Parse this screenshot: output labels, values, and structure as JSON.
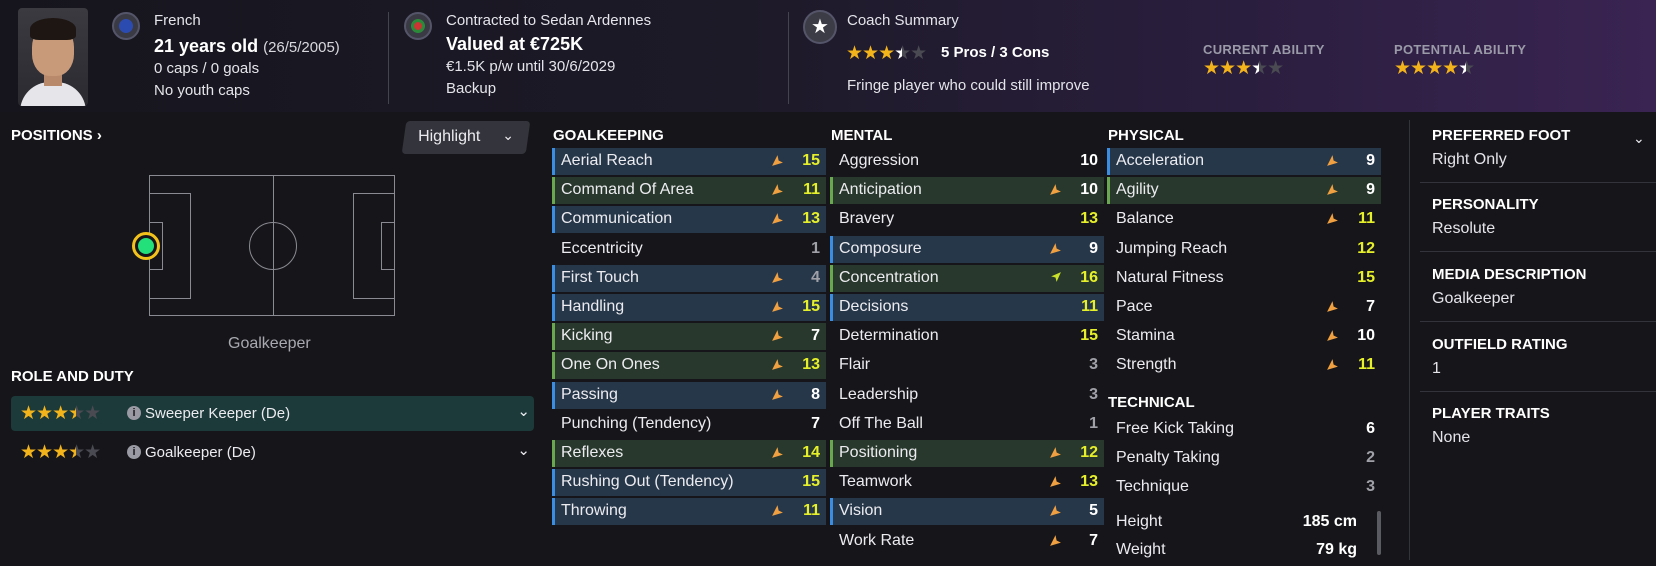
{
  "header": {
    "nationality": "French",
    "age": "21 years old",
    "dob": "(26/5/2005)",
    "caps": "0 caps / 0 goals",
    "youth_caps": "No youth caps",
    "contract_club": "Contracted to Sedan Ardennes",
    "value": "Valued at €725K",
    "wage": "€1.5K p/w until 30/6/2029",
    "squad_status": "Backup",
    "coach_title": "Coach Summary",
    "pros_cons": "5 Pros / 3 Cons",
    "coach_note": "Fringe player who could still improve",
    "coach_stars": 3.5,
    "current_ability_label": "CURRENT ABILITY",
    "current_ability_stars": 3.5,
    "potential_ability_label": "POTENTIAL ABILITY",
    "potential_ability_stars": 4.5
  },
  "positions": {
    "title": "POSITIONS",
    "highlight_label": "Highlight",
    "position_name": "Goalkeeper",
    "role_title": "ROLE AND DUTY",
    "roles": [
      {
        "name": "Sweeper Keeper (De)",
        "stars": 3.5,
        "selected": true
      },
      {
        "name": "Goalkeeper (De)",
        "stars": 3.5,
        "selected": false
      }
    ]
  },
  "goalkeeping": {
    "title": "GOALKEEPING",
    "items": [
      {
        "name": "Aerial Reach",
        "value": "15",
        "hl": "blue",
        "arrow": true
      },
      {
        "name": "Command Of Area",
        "value": "11",
        "hl": "green",
        "arrow": true
      },
      {
        "name": "Communication",
        "value": "13",
        "hl": "blue",
        "arrow": true
      },
      {
        "name": "Eccentricity",
        "value": "1",
        "hl": "",
        "arrow": false
      },
      {
        "name": "First Touch",
        "value": "4",
        "hl": "blue",
        "arrow": true
      },
      {
        "name": "Handling",
        "value": "15",
        "hl": "blue",
        "arrow": true
      },
      {
        "name": "Kicking",
        "value": "7",
        "hl": "green",
        "arrow": true
      },
      {
        "name": "One On Ones",
        "value": "13",
        "hl": "green",
        "arrow": true
      },
      {
        "name": "Passing",
        "value": "8",
        "hl": "blue",
        "arrow": true
      },
      {
        "name": "Punching (Tendency)",
        "value": "7",
        "hl": "",
        "arrow": false
      },
      {
        "name": "Reflexes",
        "value": "14",
        "hl": "green",
        "arrow": true
      },
      {
        "name": "Rushing Out (Tendency)",
        "value": "15",
        "hl": "blue",
        "arrow": false
      },
      {
        "name": "Throwing",
        "value": "11",
        "hl": "blue",
        "arrow": true
      }
    ]
  },
  "mental": {
    "title": "MENTAL",
    "items": [
      {
        "name": "Aggression",
        "value": "10",
        "hl": "",
        "arrow": false
      },
      {
        "name": "Anticipation",
        "value": "10",
        "hl": "green",
        "arrow": true
      },
      {
        "name": "Bravery",
        "value": "13",
        "hl": "",
        "arrow": false
      },
      {
        "name": "Composure",
        "value": "9",
        "hl": "blue",
        "arrow": true
      },
      {
        "name": "Concentration",
        "value": "16",
        "hl": "green",
        "arrow": "up"
      },
      {
        "name": "Decisions",
        "value": "11",
        "hl": "blue",
        "arrow": false
      },
      {
        "name": "Determination",
        "value": "15",
        "hl": "",
        "arrow": false
      },
      {
        "name": "Flair",
        "value": "3",
        "hl": "",
        "arrow": false
      },
      {
        "name": "Leadership",
        "value": "3",
        "hl": "",
        "arrow": false
      },
      {
        "name": "Off The Ball",
        "value": "1",
        "hl": "",
        "arrow": false
      },
      {
        "name": "Positioning",
        "value": "12",
        "hl": "green",
        "arrow": true
      },
      {
        "name": "Teamwork",
        "value": "13",
        "hl": "",
        "arrow": true
      },
      {
        "name": "Vision",
        "value": "5",
        "hl": "blue",
        "arrow": true
      },
      {
        "name": "Work Rate",
        "value": "7",
        "hl": "",
        "arrow": true
      }
    ]
  },
  "physical": {
    "title": "PHYSICAL",
    "items": [
      {
        "name": "Acceleration",
        "value": "9",
        "hl": "blue",
        "arrow": true
      },
      {
        "name": "Agility",
        "value": "9",
        "hl": "green",
        "arrow": true
      },
      {
        "name": "Balance",
        "value": "11",
        "hl": "",
        "arrow": true
      },
      {
        "name": "Jumping Reach",
        "value": "12",
        "hl": "",
        "arrow": false
      },
      {
        "name": "Natural Fitness",
        "value": "15",
        "hl": "",
        "arrow": false
      },
      {
        "name": "Pace",
        "value": "7",
        "hl": "",
        "arrow": true
      },
      {
        "name": "Stamina",
        "value": "10",
        "hl": "",
        "arrow": true
      },
      {
        "name": "Strength",
        "value": "11",
        "hl": "",
        "arrow": true
      }
    ]
  },
  "technical": {
    "title": "TECHNICAL",
    "items": [
      {
        "name": "Free Kick Taking",
        "value": "6",
        "hl": "",
        "arrow": false
      },
      {
        "name": "Penalty Taking",
        "value": "2",
        "hl": "",
        "arrow": false
      },
      {
        "name": "Technique",
        "value": "3",
        "hl": "",
        "arrow": false
      }
    ]
  },
  "measurements": {
    "height_label": "Height",
    "height": "185 cm",
    "weight_label": "Weight",
    "weight": "79 kg"
  },
  "details": {
    "preferred_foot_label": "PREFERRED FOOT",
    "preferred_foot": "Right Only",
    "personality_label": "PERSONALITY",
    "personality": "Resolute",
    "media_label": "MEDIA DESCRIPTION",
    "media": "Goalkeeper",
    "outfield_label": "OUTFIELD RATING",
    "outfield": "1",
    "traits_label": "PLAYER TRAITS",
    "traits": "None"
  },
  "colors": {
    "accent_blue": "#3a8de0",
    "accent_green": "#6aa84f",
    "star_gold": "#f3b31a",
    "high_value": "#e6f02a",
    "arrow_orange": "#f0a040"
  }
}
